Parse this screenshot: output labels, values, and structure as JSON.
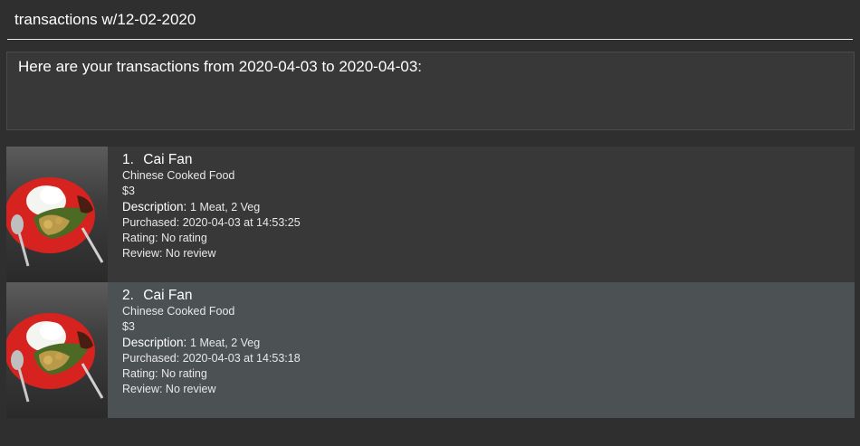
{
  "command": {
    "value": "transactions w/12-02-2020"
  },
  "result": {
    "message": "Here are your transactions from 2020-04-03 to 2020-04-03:"
  },
  "transactions": [
    {
      "index": "1.",
      "name": "Cai Fan",
      "stall": "Chinese Cooked Food",
      "price": "$3",
      "description_label": "Description:",
      "description": "1 Meat, 2 Veg",
      "purchased": "Purchased: 2020-04-03 at 14:53:25",
      "rating": "Rating: No rating",
      "review": "Review: No review"
    },
    {
      "index": "2.",
      "name": "Cai Fan",
      "stall": "Chinese Cooked Food",
      "price": "$3",
      "description_label": "Description:",
      "description": "1 Meat, 2 Veg",
      "purchased": "Purchased: 2020-04-03 at 14:53:18",
      "rating": "Rating: No rating",
      "review": "Review: No review"
    }
  ]
}
